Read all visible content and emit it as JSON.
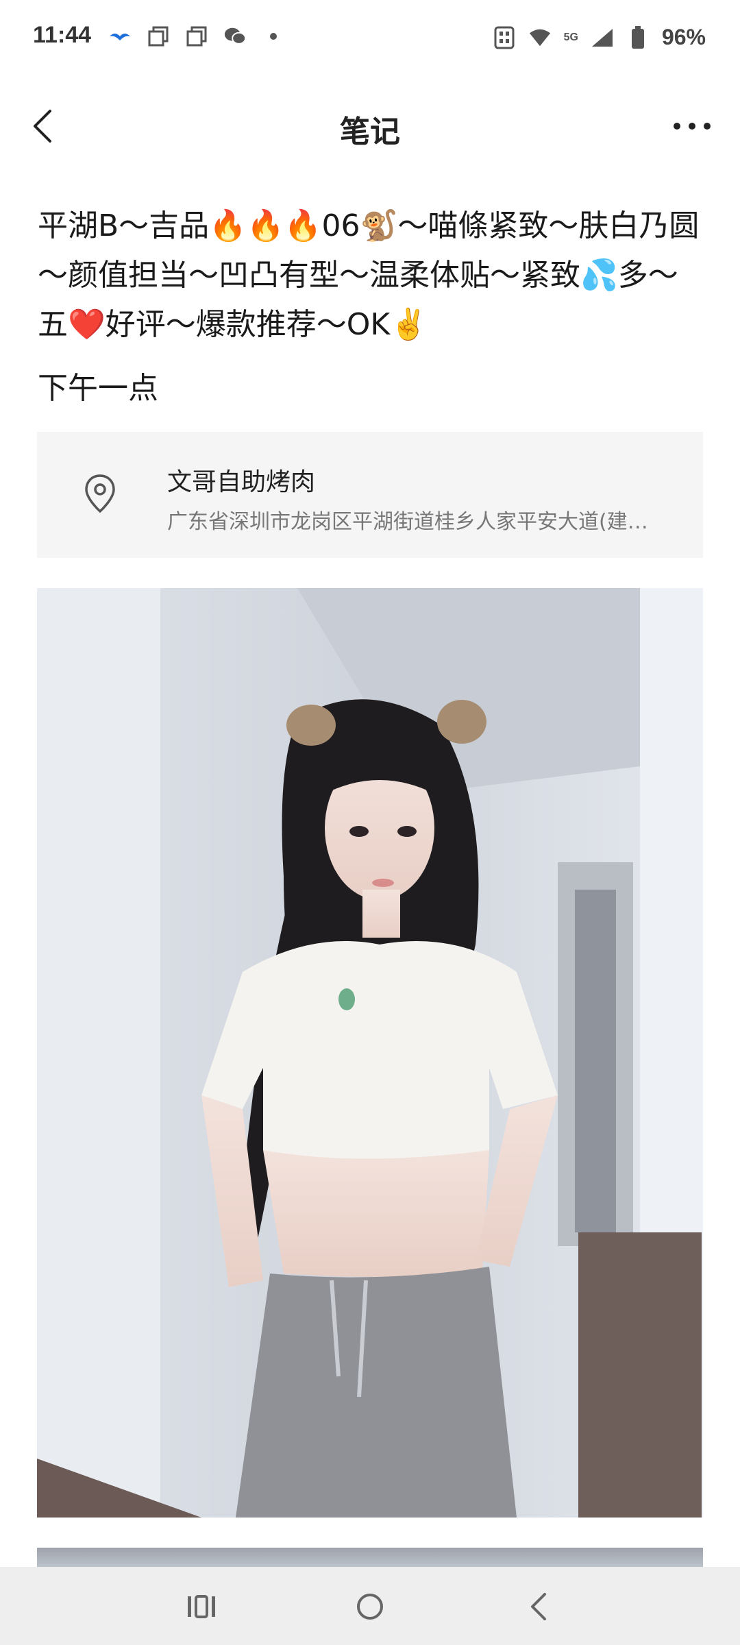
{
  "status_bar": {
    "time": "11:44",
    "network_label": "5G",
    "battery": "96%"
  },
  "header": {
    "title": "笔记"
  },
  "note": {
    "body": "平湖B～吉品🔥🔥🔥06🐒～喵條紧致～肤白乃圆～颜值担当～凹凸有型～温柔体贴～紧致💦多～五❤️好评～爆款推荐～OK✌️",
    "time_text": "下午一点"
  },
  "location": {
    "name": "文哥自助烤肉",
    "address": "广东省深圳市龙岗区平湖街道桂乡人家平安大道(建…"
  },
  "icons": {
    "back": "chevron-left-icon",
    "more": "more-dots-icon",
    "location": "location-pin-icon",
    "nav_recents": "recents-icon",
    "nav_home": "home-icon",
    "nav_back": "back-icon"
  },
  "colors": {
    "card_bg": "#f5f5f5",
    "nav_bg": "#eeeeee",
    "text": "#1a1a1a",
    "secondary_text": "#777777"
  }
}
